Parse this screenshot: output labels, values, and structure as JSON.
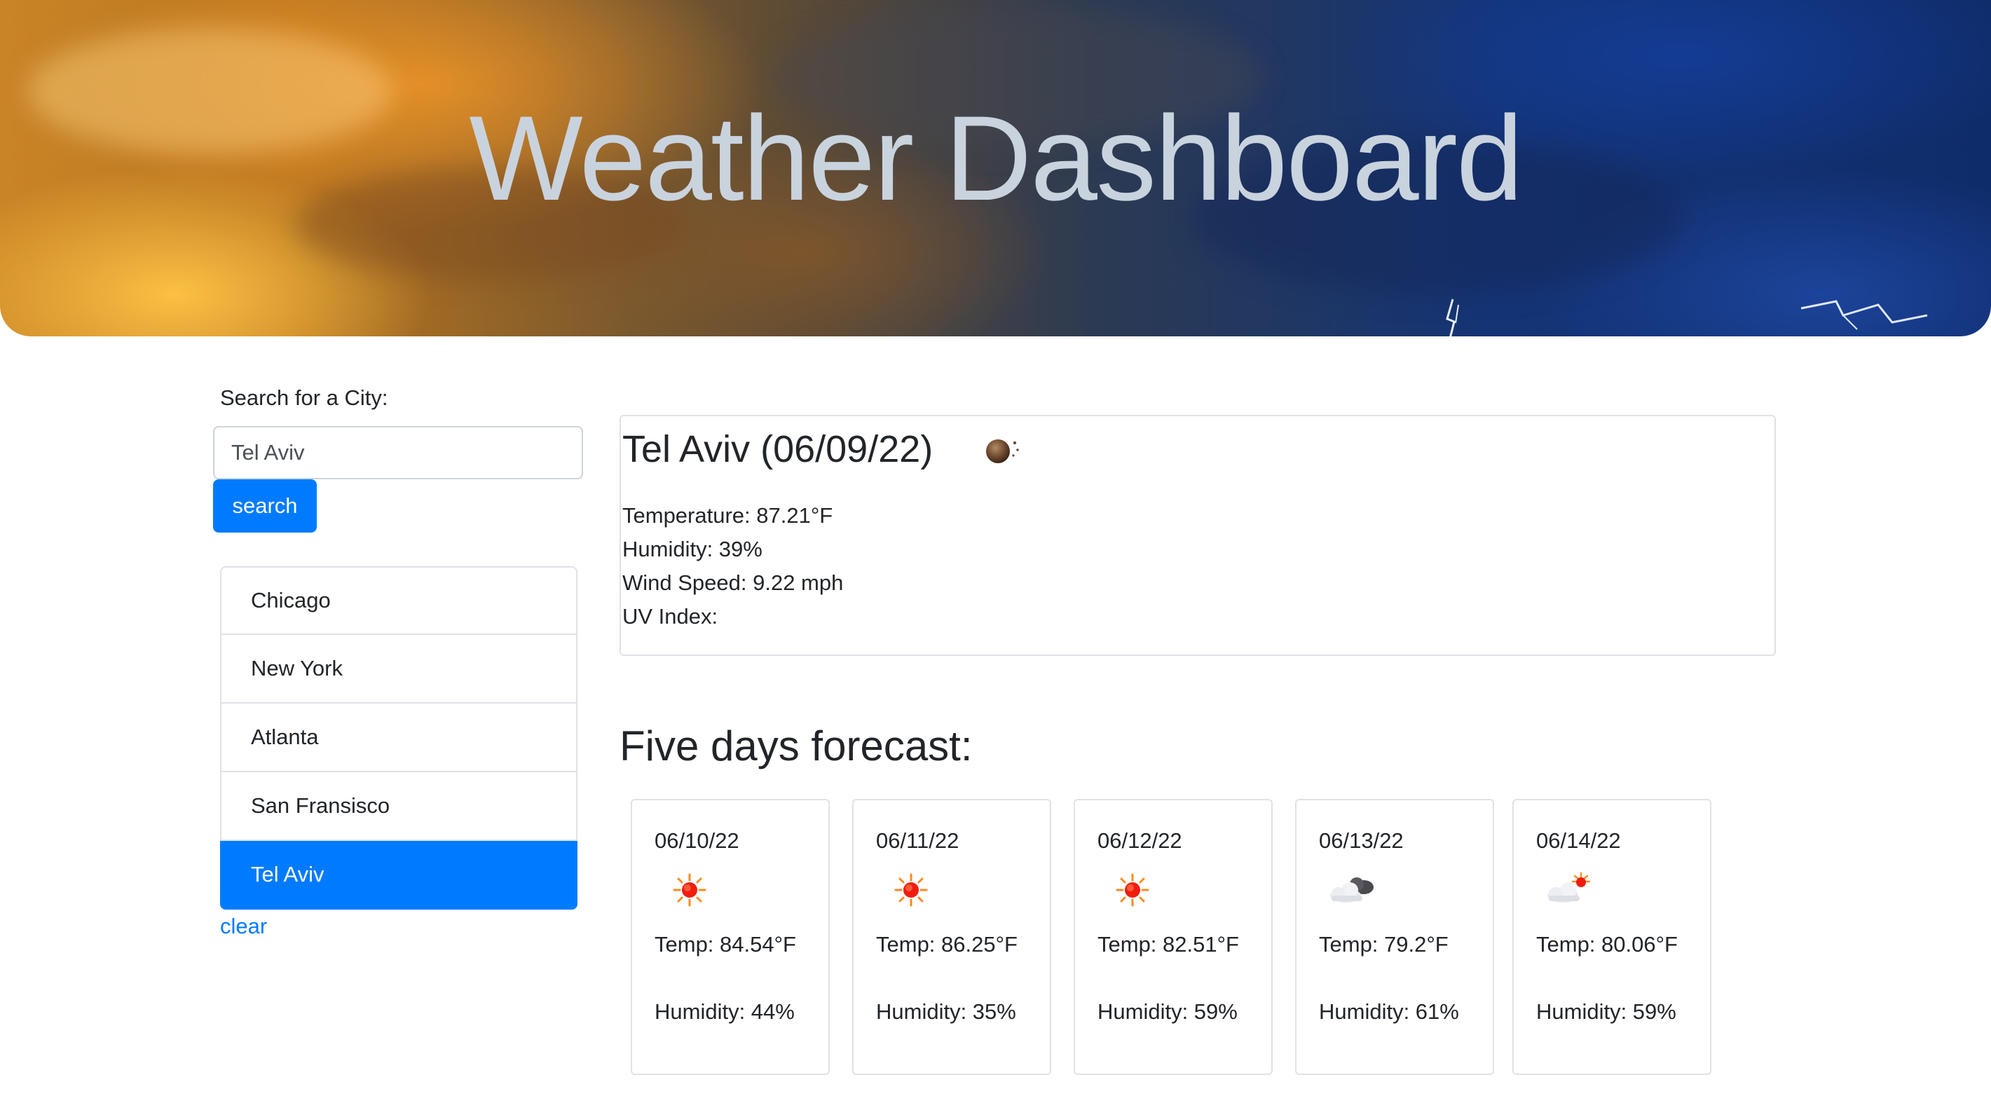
{
  "header": {
    "title": "Weather Dashboard"
  },
  "sidebar": {
    "search_label": "Search for a City:",
    "search_value": "Tel Aviv",
    "search_button": "search",
    "cities": [
      {
        "label": "Chicago",
        "active": false
      },
      {
        "label": "New York",
        "active": false
      },
      {
        "label": "Atlanta",
        "active": false
      },
      {
        "label": "San Fransisco",
        "active": false
      },
      {
        "label": "Tel Aviv",
        "active": true
      }
    ],
    "clear_label": "clear"
  },
  "current": {
    "title": "Tel Aviv (06/09/22)",
    "icon": "clear-night-icon",
    "temperature": "Temperature: 87.21°F",
    "humidity": "Humidity: 39%",
    "wind": "Wind Speed: 9.22 mph",
    "uv": "UV Index:"
  },
  "forecast": {
    "heading": "Five days forecast:",
    "days": [
      {
        "date": "06/10/22",
        "icon": "sun-icon",
        "temp": "Temp: 84.54°F",
        "humidity": "Humidity: 44%"
      },
      {
        "date": "06/11/22",
        "icon": "sun-icon",
        "temp": "Temp: 86.25°F",
        "humidity": "Humidity: 35%"
      },
      {
        "date": "06/12/22",
        "icon": "sun-icon",
        "temp": "Temp: 82.51°F",
        "humidity": "Humidity: 59%"
      },
      {
        "date": "06/13/22",
        "icon": "cloud-icon",
        "temp": "Temp: 79.2°F",
        "humidity": "Humidity: 61%"
      },
      {
        "date": "06/14/22",
        "icon": "partly-cloudy-icon",
        "temp": "Temp: 80.06°F",
        "humidity": "Humidity: 59%"
      }
    ]
  },
  "colors": {
    "accent": "#007bff",
    "border": "#dfe2e6",
    "text": "#212529"
  }
}
